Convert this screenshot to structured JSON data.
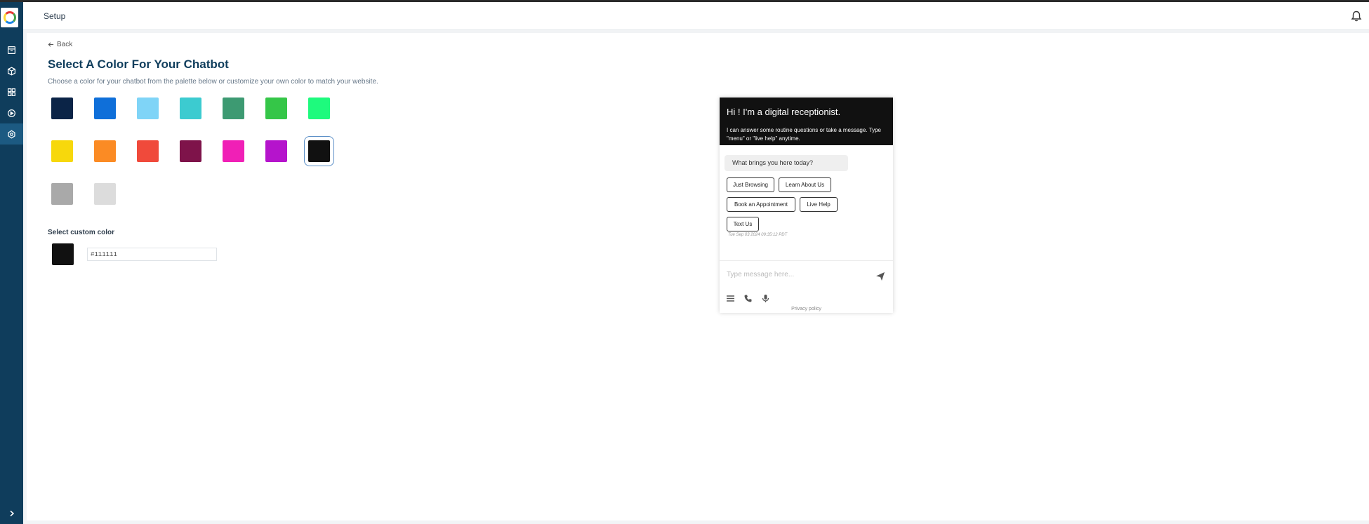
{
  "app": {
    "page_title": "Setup"
  },
  "sidebar": {
    "items": [
      {
        "icon": "archive-icon"
      },
      {
        "icon": "box-icon"
      },
      {
        "icon": "grid-icon"
      },
      {
        "icon": "play-circle-icon"
      },
      {
        "icon": "gear-icon",
        "active": true
      }
    ]
  },
  "content": {
    "back_label": "Back",
    "heading": "Select A Color For Your Chatbot",
    "description": "Choose a color for your chatbot from the palette below or customize your own color to match your website."
  },
  "palette": {
    "colors": [
      "#0b2447",
      "#0f6fd9",
      "#7fd4f7",
      "#3ccbd0",
      "#3d9a72",
      "#35c648",
      "#1efa7d",
      "#f7d80c",
      "#fb8b24",
      "#f04a3b",
      "#7e134a",
      "#f020b6",
      "#b514cc",
      "#111111",
      "#a9a9a9",
      "#dcdcdc"
    ],
    "selected": "#111111"
  },
  "custom": {
    "label": "Select custom color",
    "value": "#111111"
  },
  "chat_preview": {
    "header_title": "Hi ! I'm a digital receptionist.",
    "header_subtitle": "I can answer some routine questions or take a message. Type \"menu\" or \"live help\" anytime.",
    "bubble": "What brings you here today?",
    "options": [
      "Just Browsing",
      "Learn About Us",
      "Book an Appointment",
      "Live Help",
      "Text Us"
    ],
    "timestamp": "Tue Sep 03 2024 09:35:12 PDT",
    "input_placeholder": "Type message here...",
    "privacy": "Privacy policy"
  },
  "colors": {
    "sidebar_bg": "#0f3d5c",
    "heading": "#0f3d5c",
    "chat_header": "#111111"
  }
}
